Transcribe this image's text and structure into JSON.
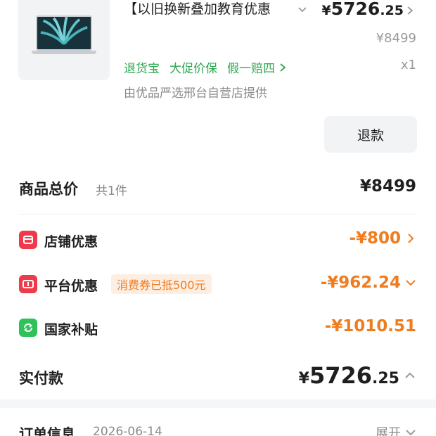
{
  "product": {
    "title": "【以旧换新叠加教育优惠",
    "price": {
      "currency": "¥",
      "integer": "5726",
      "decimal": ".25"
    },
    "original_price": "¥8499",
    "quantity": "x1",
    "services": [
      "退货宝",
      "大促价保",
      "假一赔四"
    ],
    "seller": "由优品严选邢台自营店提供",
    "refund_label": "退款"
  },
  "summary": {
    "total_label": "商品总价",
    "count": "共1件",
    "total_value": "¥8499"
  },
  "discounts": [
    {
      "label": "店铺优惠",
      "value": "-¥800",
      "icon": "store-coupon-icon",
      "color": "#ee3a4a"
    },
    {
      "label": "平台优惠",
      "value": "-¥962.24",
      "badge": "消费券已抵500元",
      "icon": "platform-coupon-icon",
      "color": "#ee3a4a"
    },
    {
      "label": "国家补贴",
      "value": "-¥1010.51",
      "icon": "subsidy-icon",
      "color": "#2fc25b"
    }
  ],
  "paid": {
    "label": "实付款",
    "currency": "¥",
    "integer": "5726",
    "decimal": ".25"
  },
  "order": {
    "label": "订单信息",
    "date": "2026-06-14",
    "expand_label": "展开"
  },
  "colors": {
    "accent": "#f07c1e",
    "service_green": "#2ea84f"
  }
}
